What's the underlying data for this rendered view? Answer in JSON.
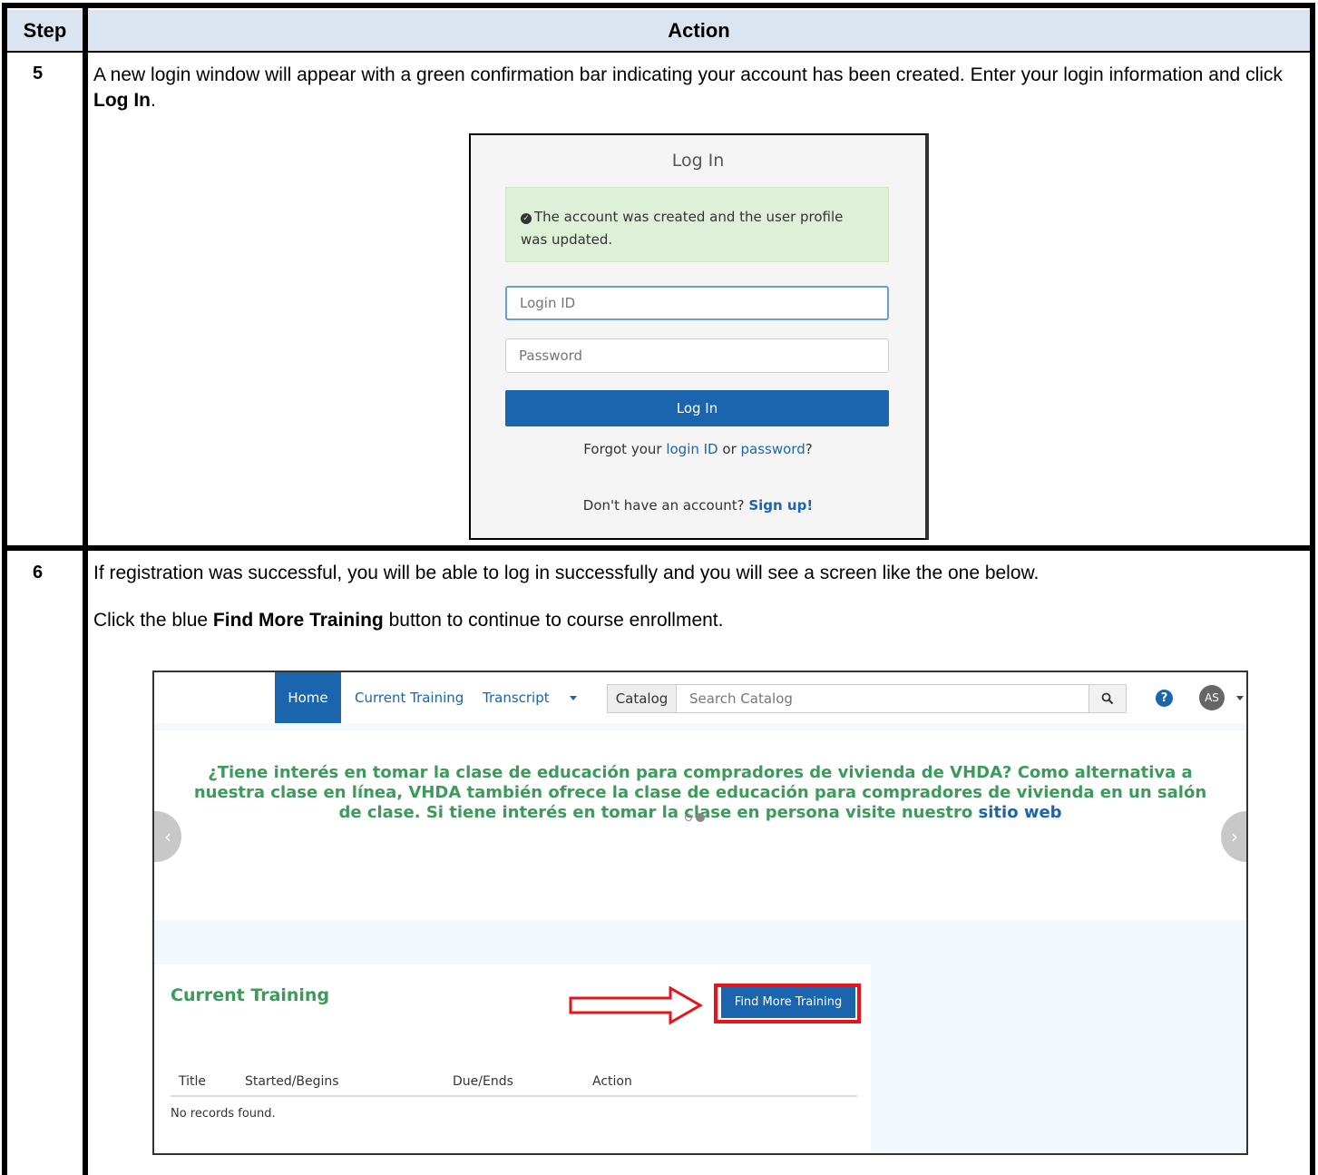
{
  "table": {
    "header": {
      "step": "Step",
      "action": "Action"
    },
    "rows": [
      {
        "step": "5",
        "text_before": "A new login window will appear with a green confirmation bar indicating your account has been created. Enter your login information and click ",
        "bold": "Log In",
        "text_after": "."
      },
      {
        "step": "6",
        "line1": "If registration was successful, you will be able to log in successfully and you will see a screen like the one below.",
        "line2_before": "Click the blue ",
        "line2_bold": "Find More Training",
        "line2_after": " button to continue to course enrollment."
      }
    ]
  },
  "login_screen": {
    "title": "Log In",
    "alert": "The account was created and the user profile was updated.",
    "login_id_placeholder": "Login ID",
    "password_placeholder": "Password",
    "button": "Log In",
    "forgot_prefix": "Forgot your ",
    "forgot_login_link": "login ID",
    "forgot_or": " or ",
    "forgot_password_link": "password",
    "forgot_suffix": "?",
    "signup_prefix": "Don't have an account? ",
    "signup_link": "Sign up!",
    "alert_color": "#dff0d8",
    "button_color": "#1a65ad"
  },
  "lms_screen": {
    "nav": {
      "home": "Home",
      "current_training": "Current Training",
      "transcript": "Transcript",
      "catalog": "Catalog",
      "search_placeholder": "Search Catalog",
      "avatar": "AS",
      "help_icon": "?"
    },
    "banner": {
      "text": "¿Tiene interés en tomar la clase de educación para compradores de vivienda de VHDA? Como alternativa a nuestra clase en línea, VHDA también ofrece la clase de educación para compradores de vivienda en un salón de clase. Si tiene interés en tomar la clase en persona visite nuestro ",
      "link": "sitio web",
      "text_color": "#3c9a5b"
    },
    "current_training": {
      "title": "Current Training",
      "button": "Find More Training",
      "columns": [
        "Title",
        "Started/Begins",
        "Due/Ends",
        "Action"
      ],
      "empty": "No records found."
    },
    "highlight_color": "#e8141c"
  }
}
